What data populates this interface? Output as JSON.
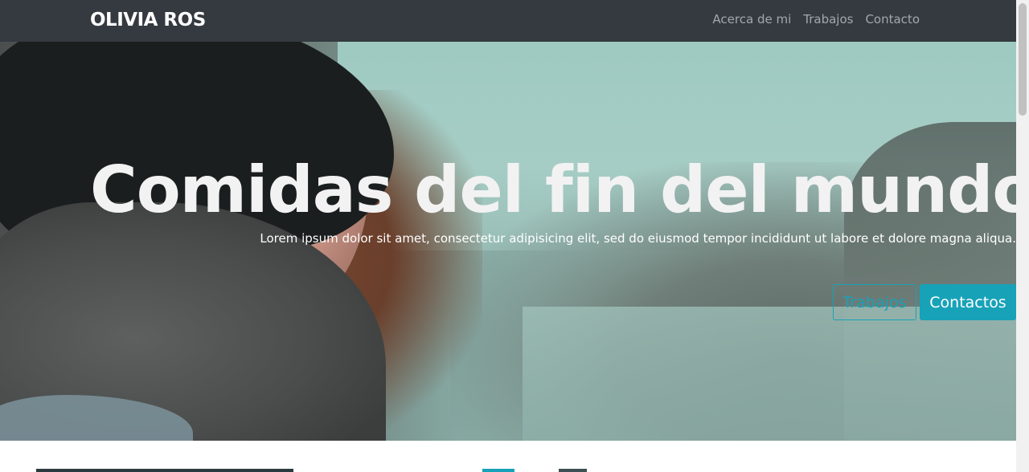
{
  "navbar": {
    "brand": "OLIVIA ROS",
    "links": [
      "Acerca de mi",
      "Trabajos",
      "Contacto"
    ]
  },
  "hero": {
    "title": "Comidas del fin del mundo",
    "lead": "Lorem ipsum dolor sit amet, consectetur adipisicing elit, sed do eiusmod tempor incididunt ut labore et dolore magna aliqua.",
    "buttons": {
      "secondary": "Trabajos",
      "primary": "Contactos"
    },
    "background_image": "woman-in-beanie-photo"
  },
  "colors": {
    "navbar_bg": "#343a40",
    "accent": "#17a2b8"
  }
}
